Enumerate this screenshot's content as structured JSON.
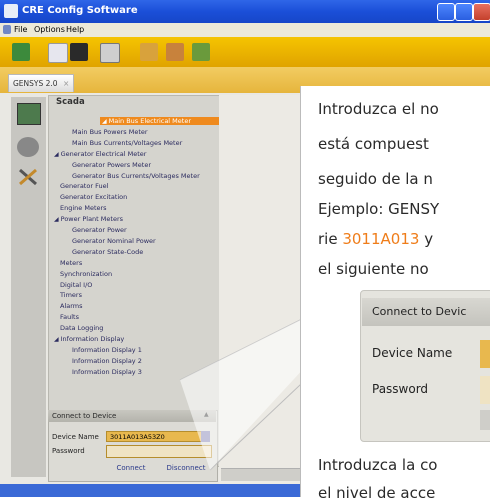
{
  "window": {
    "title": "CRE Config Software"
  },
  "menu": {
    "file": "File",
    "options": "Options",
    "help": "Help"
  },
  "tabs": [
    {
      "label": "GENSYS 2.0"
    }
  ],
  "panel": {
    "title": "Scada"
  },
  "tree": [
    {
      "label": "Main Bus Electrical Meter",
      "indent": 0,
      "expanded": true,
      "selected": true
    },
    {
      "label": "Main Bus Powers Meter",
      "indent": 2
    },
    {
      "label": "Main Bus Currents/Voltages Meter",
      "indent": 2
    },
    {
      "label": "Generator Electrical Meter",
      "indent": 0,
      "expanded": true
    },
    {
      "label": "Generator Powers Meter",
      "indent": 2
    },
    {
      "label": "Generator Bus Currents/Voltages Meter",
      "indent": 2
    },
    {
      "label": "Generator Fuel",
      "indent": 1
    },
    {
      "label": "Generator Excitation",
      "indent": 1
    },
    {
      "label": "Engine Meters",
      "indent": 1
    },
    {
      "label": "Power Plant Meters",
      "indent": 0,
      "expanded": true
    },
    {
      "label": "Generator Power",
      "indent": 2
    },
    {
      "label": "Generator Nominal Power",
      "indent": 2
    },
    {
      "label": "Generator State-Code",
      "indent": 2
    },
    {
      "label": "Meters",
      "indent": 1
    },
    {
      "label": "Synchronization",
      "indent": 1
    },
    {
      "label": "Digital I/O",
      "indent": 1
    },
    {
      "label": "Timers",
      "indent": 1
    },
    {
      "label": "Alarms",
      "indent": 1
    },
    {
      "label": "Faults",
      "indent": 1
    },
    {
      "label": "Data Logging",
      "indent": 1
    },
    {
      "label": "Information Display",
      "indent": 0,
      "expanded": true
    },
    {
      "label": "Information Display 1",
      "indent": 2
    },
    {
      "label": "Information Display 2",
      "indent": 2
    },
    {
      "label": "Information Display 3",
      "indent": 2
    }
  ],
  "connect": {
    "header": "Connect to Device",
    "device_label": "Device Name",
    "device_value": "3011A013A53Z0",
    "password_label": "Password",
    "connect_btn": "Connect",
    "disconnect_btn": "Disconnect"
  },
  "callout": {
    "line1": "Introduzca el no",
    "line2": "está compuest",
    "line3": "seguido de la n",
    "line4": "Ejemplo: GENSY",
    "line5a": "rie ",
    "line5b": "3011A013",
    "line5c": " y",
    "line6": "el siguiente no",
    "line7": "Introduzca la co",
    "line8": "el nivel de acce",
    "zoom_header": "Connect to Devic",
    "zoom_device": "Device Name",
    "zoom_password": "Password"
  },
  "colors": {
    "accent": "#ef7d1a",
    "toolbar": "#f0b800",
    "selected": "#ef8a1e",
    "titlebar": "#2458dc"
  }
}
